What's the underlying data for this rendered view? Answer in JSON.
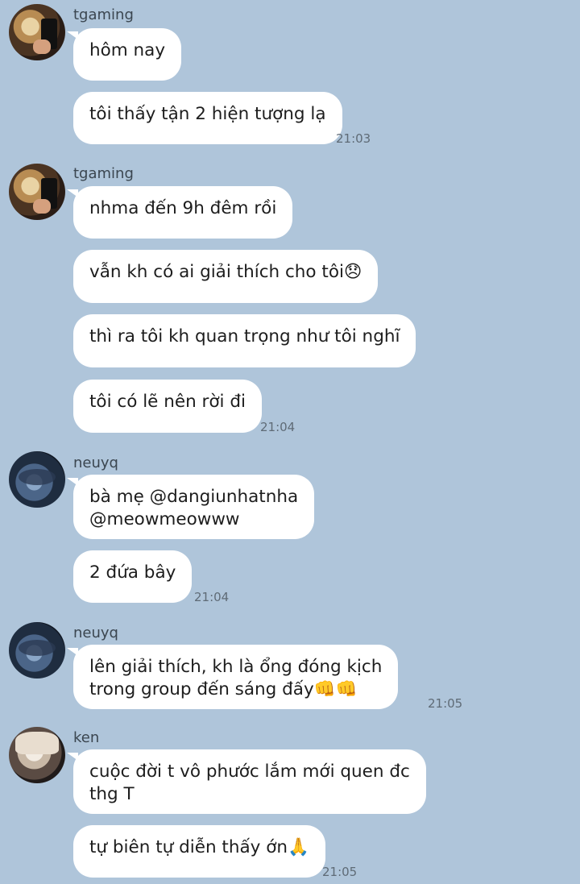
{
  "groups": [
    {
      "user": "tgaming",
      "avatar_icon": "tgaming-avatar",
      "messages": [
        "hôm nay",
        "tôi thấy tận 2 hiện tượng lạ"
      ],
      "time": "21:03"
    },
    {
      "user": "tgaming",
      "avatar_icon": "tgaming-avatar",
      "messages": [
        "nhma đến 9h đêm rồi",
        "vẫn kh có ai giải thích cho tôi😞",
        "thì ra tôi kh quan trọng như tôi nghĩ",
        "tôi có lẽ nên rời đi"
      ],
      "time": "21:04"
    },
    {
      "user": "neuyq",
      "avatar_icon": "neuyq-avatar",
      "messages": [
        "bà mẹ @dangiunhatnha\n@meowmeowww",
        "2 đứa bây"
      ],
      "time": "21:04"
    },
    {
      "user": "neuyq",
      "avatar_icon": "neuyq-avatar",
      "messages": [
        "lên giải thích, kh là ổng đóng kịch\ntrong group đến sáng đấy👊👊"
      ],
      "time": "21:05"
    },
    {
      "user": "ken",
      "avatar_icon": "ken-avatar",
      "messages": [
        "cuộc đời t vô phước lắm mới quen đc\nthg T",
        "tự biên tự diễn thấy ớn🙏"
      ],
      "time": "21:05"
    }
  ],
  "colors": {
    "background": "#afc5da",
    "bubble": "#ffffff",
    "name_text": "#3b4650",
    "time_text": "#5f6b76"
  }
}
